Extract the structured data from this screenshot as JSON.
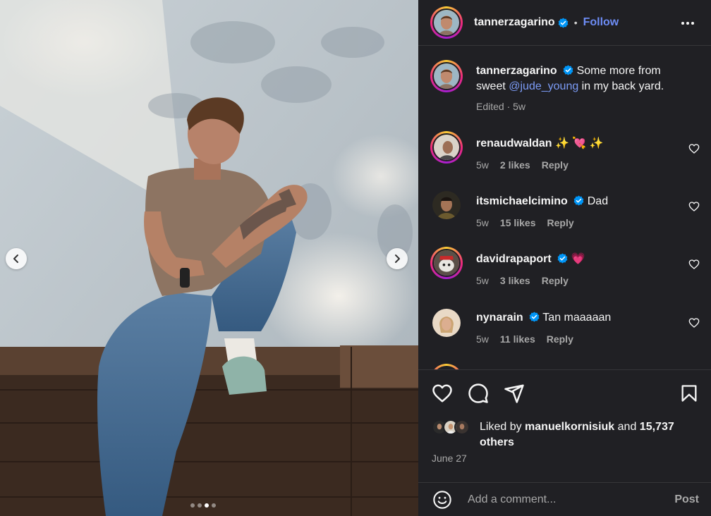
{
  "post": {
    "author": "tannerzagarino",
    "follow_label": "Follow",
    "separator": "•"
  },
  "caption": {
    "username": "tannerzagarino",
    "text_before": "Some more from sweet ",
    "mention": "@jude_young",
    "text_after": " in my back yard.",
    "meta": "Edited · 5w"
  },
  "comments": [
    {
      "username": "renaudwaldan",
      "verified": false,
      "text": "✨ 💘 ✨",
      "age": "5w",
      "likes": "2 likes",
      "reply": "Reply"
    },
    {
      "username": "itsmichaelcimino",
      "verified": true,
      "text": "Dad",
      "age": "5w",
      "likes": "15 likes",
      "reply": "Reply"
    },
    {
      "username": "davidrapaport",
      "verified": true,
      "text": "💗",
      "age": "5w",
      "likes": "3 likes",
      "reply": "Reply"
    },
    {
      "username": "nynarain",
      "verified": true,
      "text": "Tan maaaaan",
      "age": "5w",
      "likes": "11 likes",
      "reply": "Reply"
    }
  ],
  "likes": {
    "prefix": "Liked by ",
    "user": "manuelkornisiuk",
    "middle": " and ",
    "count": "15,737 others"
  },
  "date": "June 27",
  "composer": {
    "placeholder": "Add a comment...",
    "post_label": "Post"
  },
  "carousel": {
    "slide_count": 4,
    "active_index": 2
  },
  "icons": [
    "chevron-left-icon",
    "chevron-right-icon",
    "verified-icon",
    "more-icon",
    "heart-icon",
    "comment-icon",
    "share-icon",
    "bookmark-icon",
    "emoji-icon"
  ],
  "colors": {
    "panel": "#202024",
    "link": "#6d8cf5",
    "verified": "#0095f6",
    "muted": "#a8a8a8"
  }
}
